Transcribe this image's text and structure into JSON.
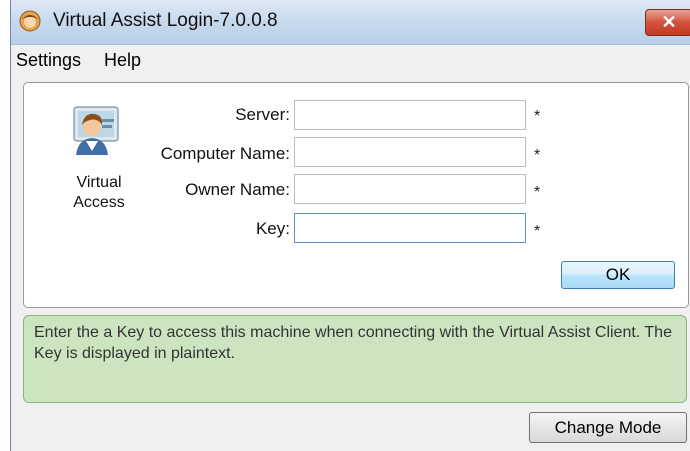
{
  "window": {
    "title": "Virtual Assist Login-7.0.0.8",
    "close_label": "✕"
  },
  "menu": {
    "items": [
      {
        "label": "Settings"
      },
      {
        "label": "Help"
      }
    ]
  },
  "avatar": {
    "label_line1": "Virtual",
    "label_line2": "Access"
  },
  "form": {
    "fields": [
      {
        "label": "Server:",
        "value": "",
        "required_mark": "*"
      },
      {
        "label": "Computer Name:",
        "value": "",
        "required_mark": "*"
      },
      {
        "label": "Owner Name:",
        "value": "",
        "required_mark": "*"
      },
      {
        "label": "Key:",
        "value": "",
        "required_mark": "*"
      }
    ],
    "ok_label": "OK"
  },
  "info": {
    "text": "Enter the a Key to access this machine when connecting with the Virtual Assist Client. The Key is displayed in plaintext."
  },
  "footer": {
    "change_mode_label": "Change Mode"
  },
  "colors": {
    "info_background": "#cce5c0",
    "close_button": "#c23a22",
    "ok_border": "#3c7fb1"
  }
}
